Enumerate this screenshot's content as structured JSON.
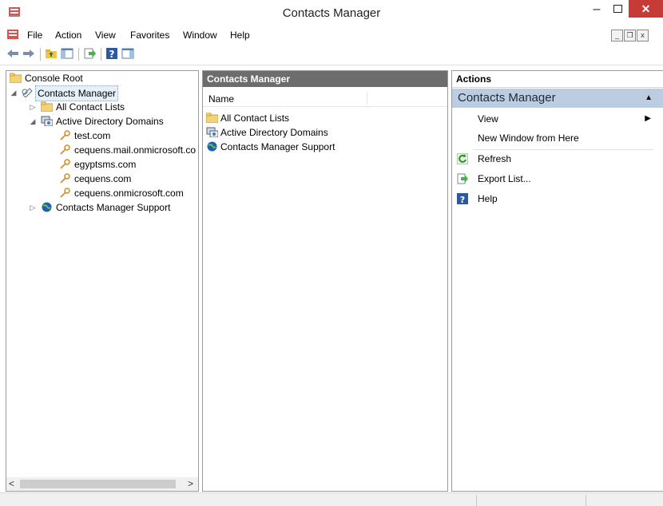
{
  "window": {
    "title": "Contacts Manager",
    "minimize": "–",
    "close": "✕"
  },
  "menu": {
    "items": [
      {
        "label": "File"
      },
      {
        "label": "Action"
      },
      {
        "label": "View"
      },
      {
        "label": "Favorites"
      },
      {
        "label": "Window"
      },
      {
        "label": "Help"
      }
    ],
    "mdi": {
      "minimize": "_",
      "restore": "❐",
      "close": "x"
    }
  },
  "toolbar": {
    "icons": [
      "back-icon",
      "forward-icon",
      "up-folder-icon",
      "show-hide-tree-icon",
      "export-list-icon",
      "help-icon",
      "show-hide-action-pane-icon"
    ]
  },
  "tree": {
    "root": "Console Root",
    "selected": "Contacts Manager",
    "items": [
      {
        "label": "All Contact Lists",
        "icon": "folder-icon"
      },
      {
        "label": "Active Directory Domains",
        "icon": "directory-icon"
      },
      {
        "label": "test.com",
        "icon": "key-icon"
      },
      {
        "label": "cequens.mail.onmicrosoft.co",
        "icon": "key-icon"
      },
      {
        "label": "egyptsms.com",
        "icon": "key-icon"
      },
      {
        "label": "cequens.com",
        "icon": "key-icon"
      },
      {
        "label": "cequens.onmicrosoft.com",
        "icon": "key-icon"
      },
      {
        "label": "Contacts Manager Support",
        "icon": "globe-icon"
      }
    ],
    "scroll_left": "<",
    "scroll_right": ">"
  },
  "middle": {
    "header": "Contacts Manager",
    "column_name": "Name",
    "rows": [
      {
        "label": "All Contact Lists",
        "icon": "folder-icon"
      },
      {
        "label": "Active Directory Domains",
        "icon": "directory-icon"
      },
      {
        "label": "Contacts Manager Support",
        "icon": "globe-icon"
      }
    ]
  },
  "actions": {
    "header": "Actions",
    "section": "Contacts Manager",
    "items": [
      {
        "label": "View",
        "icon": ""
      },
      {
        "label": "New Window from Here",
        "icon": ""
      },
      {
        "label": "Refresh",
        "icon": "refresh-icon"
      },
      {
        "label": "Export List...",
        "icon": "export-list-icon"
      },
      {
        "label": "Help",
        "icon": "help-icon"
      }
    ]
  },
  "colors": {
    "accent": "#bccde2",
    "close": "#c73b37",
    "pane_header": "#6d6d6d"
  }
}
